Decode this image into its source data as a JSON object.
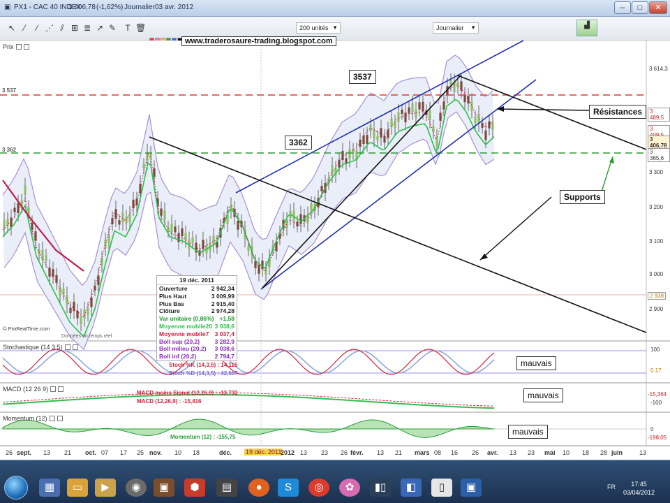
{
  "window": {
    "title": "PX1 - CAC 40 INDEX",
    "last_price": "3 406,78",
    "change": "(-1,62%)",
    "period": "Journalier",
    "date": "03 avr. 2012"
  },
  "toolbar": {
    "units_select": "200 unités",
    "period_select": "Journalier"
  },
  "chart": {
    "watermark": "www.traderosaure-trading.blogspot.com",
    "price_pane_label": "Prix",
    "credit": "© ProRealTime.com",
    "credit2": "Données en temps réel",
    "ref_levels": [
      "3 537",
      "3 362"
    ],
    "y_labels": [
      "3 614,3",
      "3 489,5",
      "3 409,5",
      "3 406,78",
      "3 365,6",
      "3 300",
      "3 200",
      "3 100",
      "3 000",
      "2 938",
      "2 900"
    ],
    "annotations": {
      "a3537": "3537",
      "a3362": "3362",
      "resistances": "Résistances",
      "supports": "Supports",
      "mauvais_stoch": "mauvais",
      "mauvais_macd": "mauvais",
      "mauvais_mom": "mauvais"
    },
    "tooltip": {
      "date": "19 déc. 2011",
      "rows": [
        {
          "label": "Ouverture",
          "value": "2 942,34",
          "color": "#222222"
        },
        {
          "label": "Plus Haut",
          "value": "3 009,99",
          "color": "#222222"
        },
        {
          "label": "Plus Bas",
          "value": "2 915,40",
          "color": "#222222"
        },
        {
          "label": "Clôture",
          "value": "2 974,28",
          "color": "#222222"
        },
        {
          "label": "Var unitaire (0,86%)",
          "value": "+1,58",
          "color": "#1a9a2a"
        },
        {
          "label": "Moyenne mobile20",
          "value": "3 038,6",
          "color": "#2fbf4a"
        },
        {
          "label": "Moyenne mobile7",
          "value": "3 037,4",
          "color": "#d02040"
        },
        {
          "label": "Boll sup (20,2)",
          "value": "3 282,9",
          "color": "#8a2bbd"
        },
        {
          "label": "Boll milieu (20,2)",
          "value": "3 038,6",
          "color": "#8a2bbd"
        },
        {
          "label": "Boll inf (20,2)",
          "value": "2 794,7",
          "color": "#8a2bbd"
        }
      ]
    },
    "stoch": {
      "title": "Stochastique (14 3 5)",
      "k": "Stoch %K (14,3,5) : 14,115",
      "d": "Stoch %D (14,3,5) : 42,667",
      "scale": [
        "100",
        "0.17"
      ]
    },
    "macd": {
      "title": "MACD (12 26 9)",
      "signal": "MACD moins Signal (12,26,9) : -13,732",
      "macd": "MACD (12,26,9) : -15,416",
      "scale": [
        "-15,364",
        "-100"
      ]
    },
    "momentum": {
      "title": "Momentum (12)",
      "value": "Momentum (12) : -155,75",
      "scale": [
        "0",
        "-198,05"
      ]
    }
  },
  "date_axis": [
    {
      "label": "26",
      "bold": false
    },
    {
      "label": "sept.",
      "bold": true
    },
    {
      "label": "13",
      "bold": false
    },
    {
      "label": "21",
      "bold": false
    },
    {
      "label": "oct.",
      "bold": true
    },
    {
      "label": "07",
      "bold": false
    },
    {
      "label": "17",
      "bold": false
    },
    {
      "label": "25",
      "bold": false
    },
    {
      "label": "nov.",
      "bold": true
    },
    {
      "label": "10",
      "bold": false
    },
    {
      "label": "18",
      "bold": false
    },
    {
      "label": "déc.",
      "bold": true
    },
    {
      "label": "19 déc. 2011",
      "bold": false,
      "current": true
    },
    {
      "label": "2012",
      "bold": true
    },
    {
      "label": "13",
      "bold": false
    },
    {
      "label": "23",
      "bold": false
    },
    {
      "label": "26",
      "bold": false
    },
    {
      "label": "févr.",
      "bold": true
    },
    {
      "label": "13",
      "bold": false
    },
    {
      "label": "21",
      "bold": false
    },
    {
      "label": "mars",
      "bold": true
    },
    {
      "label": "08",
      "bold": false
    },
    {
      "label": "16",
      "bold": false
    },
    {
      "label": "26",
      "bold": false
    },
    {
      "label": "avr.",
      "bold": true
    },
    {
      "label": "13",
      "bold": false
    },
    {
      "label": "23",
      "bold": false
    },
    {
      "label": "mai",
      "bold": true
    },
    {
      "label": "10",
      "bold": false
    },
    {
      "label": "18",
      "bold": false
    },
    {
      "label": "28",
      "bold": false
    },
    {
      "label": "juin",
      "bold": true
    },
    {
      "label": "13",
      "bold": false
    }
  ],
  "taskbar": {
    "lang": "FR",
    "time": "17:45",
    "date": "03/04/2012"
  },
  "colors": {
    "resistance_line": "#d83a3a",
    "support_line": "#2f9a2f",
    "channel": "#1f2fae",
    "bollinger": "#a98fd6",
    "ma20": "#2fbf4a",
    "ma7": "#c21a4a"
  }
}
